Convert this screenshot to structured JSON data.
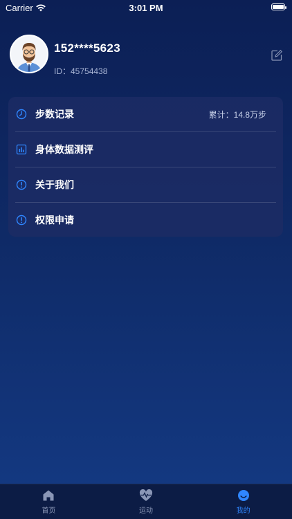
{
  "status_bar": {
    "carrier": "Carrier",
    "time": "3:01 PM"
  },
  "profile": {
    "phone": "152****5623",
    "id_text": "ID：45754438"
  },
  "menu": [
    {
      "label": "步数记录",
      "extra": "累计：14.8万步",
      "icon": "clock-icon"
    },
    {
      "label": "身体数据测评",
      "extra": "",
      "icon": "bar-chart-icon"
    },
    {
      "label": "关于我们",
      "extra": "",
      "icon": "info-icon"
    },
    {
      "label": "权限申请",
      "extra": "",
      "icon": "info-icon"
    }
  ],
  "tabs": [
    {
      "label": "首页",
      "icon": "home-icon",
      "active": false
    },
    {
      "label": "运动",
      "icon": "heartbeat-icon",
      "active": false
    },
    {
      "label": "我的",
      "icon": "smile-icon",
      "active": true
    }
  ],
  "colors": {
    "accent": "#2f86ff",
    "background_top": "#0c1f55",
    "background_bottom": "#143a84",
    "card": "#1c2c64"
  }
}
